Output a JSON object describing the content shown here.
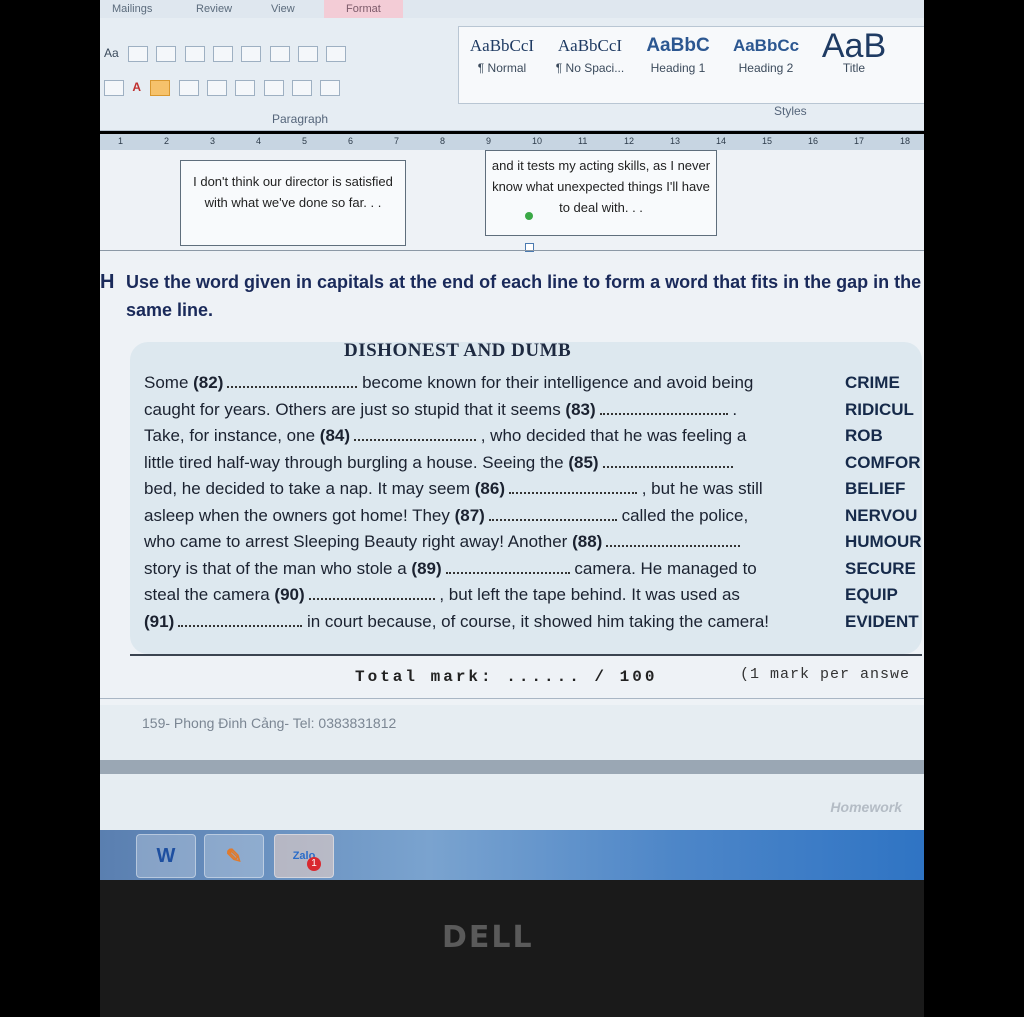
{
  "ribbon": {
    "tabs": [
      "Mailings",
      "Review",
      "View",
      "Format"
    ],
    "font_size_label": "Aa",
    "paragraph_label": "Paragraph",
    "styles_label": "Styles",
    "styles": [
      {
        "sample": "AaBbCcI",
        "name": "¶ Normal"
      },
      {
        "sample": "AaBbCcI",
        "name": "¶ No Spaci..."
      },
      {
        "sample": "AaBbC",
        "name": "Heading 1"
      },
      {
        "sample": "AaBbCc",
        "name": "Heading 2"
      },
      {
        "sample": "AaB",
        "name": "Title"
      }
    ],
    "colors": {
      "accent": "#f6c26b",
      "ribbon_bg": "#e6edf3"
    }
  },
  "ruler": {
    "numbers": [
      "1",
      "2",
      "3",
      "4",
      "5",
      "6",
      "7",
      "8",
      "9",
      "10",
      "11",
      "12",
      "13",
      "14",
      "15",
      "16",
      "17",
      "18"
    ]
  },
  "speech_bubbles": [
    "I don't think our director is satisfied with what we've done so far. . .",
    "and it tests my acting skills, as I never know what unexpected things I'll have to deal with. . ."
  ],
  "exercise": {
    "letter": "H",
    "instruction": "Use the word given in capitals at the end of each line to form a word that fits in the gap in the same line.",
    "title": "DISHONEST AND DUMB",
    "lines": [
      {
        "pre": "Some ",
        "num": "(82)",
        "post": " become known for their intelligence and avoid being",
        "cap": "CRIME"
      },
      {
        "pre": "caught for years. Others are just so stupid that it seems ",
        "num": "(83)",
        "post": " .",
        "cap": "RIDICUL"
      },
      {
        "pre": "Take, for instance, one ",
        "num": "(84)",
        "post": " , who decided that he was feeling a",
        "cap": "ROB"
      },
      {
        "pre": "little tired half-way through burgling a house. Seeing the ",
        "num": "(85)",
        "post": "",
        "cap": "COMFOR"
      },
      {
        "pre": "bed, he decided to take a nap. It may seem ",
        "num": "(86)",
        "post": " , but he was still",
        "cap": "BELIEF"
      },
      {
        "pre": "asleep when the owners got home! They ",
        "num": "(87)",
        "post": " called the police,",
        "cap": "NERVOU"
      },
      {
        "pre": "who came to arrest Sleeping Beauty right away! Another ",
        "num": "(88)",
        "post": "",
        "cap": "HUMOUR"
      },
      {
        "pre": "story is that of the man who stole a ",
        "num": "(89)",
        "post": " camera. He managed to",
        "cap": "SECURE"
      },
      {
        "pre": "steal the camera ",
        "num": "(90)",
        "post": " , but left the tape behind. It was used as",
        "cap": "EQUIP"
      },
      {
        "pre": "",
        "num": "(91)",
        "post": " in court because, of course, it showed him taking the camera!",
        "cap": "EVIDENT"
      }
    ],
    "total_mark": "Total mark:  ......  / 100",
    "mark_note": "(1 mark per answe"
  },
  "footer": {
    "address": "159- Phong Đinh Cảng- Tel: 0383831812",
    "homework": "Homework"
  },
  "taskbar": {
    "apps": [
      {
        "icon": "word-icon",
        "glyph": "W"
      },
      {
        "icon": "paint-icon",
        "glyph": "✎"
      },
      {
        "icon": "zalo-icon",
        "glyph": "Zalo",
        "badge": "1"
      }
    ]
  },
  "monitor_brand": "DELL"
}
